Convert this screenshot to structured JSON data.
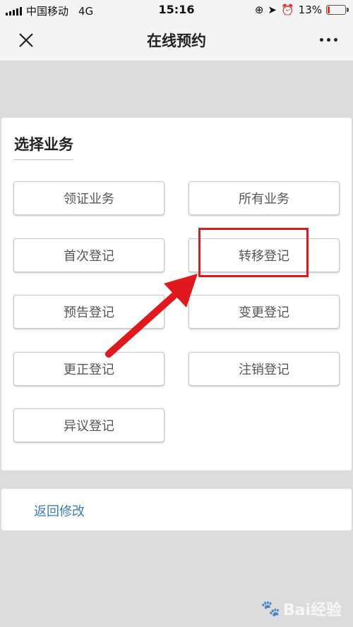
{
  "status_bar": {
    "carrier": "中国移动",
    "network": "4G",
    "time": "15:16",
    "battery": "13%",
    "battery_level": 0.13
  },
  "navbar": {
    "title": "在线预约"
  },
  "section": {
    "title": "选择业务"
  },
  "buttons": [
    {
      "label": "领证业务"
    },
    {
      "label": "所有业务"
    },
    {
      "label": "首次登记"
    },
    {
      "label": "转移登记"
    },
    {
      "label": "预告登记"
    },
    {
      "label": "变更登记"
    },
    {
      "label": "更正登记"
    },
    {
      "label": "注销登记"
    },
    {
      "label": "异议登记"
    }
  ],
  "footer": {
    "back_label": "返回修改"
  },
  "watermark": "Bai经验",
  "colors": {
    "annotation": "#e0191f",
    "link": "#3d7ab8"
  }
}
